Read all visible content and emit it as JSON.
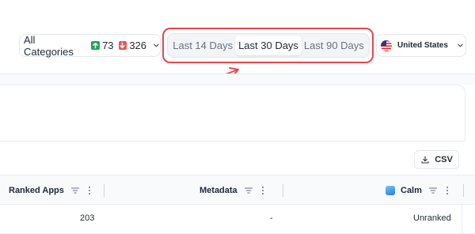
{
  "filters": {
    "category_label": "All Categories",
    "up_count": "73",
    "down_count": "326",
    "up_color": "#22a55a",
    "down_color": "#ef5350"
  },
  "date_range": {
    "options": [
      "Last 14 Days",
      "Last 30 Days",
      "Last 90 Days"
    ],
    "selected": "Last 30 Days",
    "highlight_color": "#e5484d"
  },
  "country": {
    "label": "United States",
    "flag_icon": "us-flag-icon"
  },
  "toolbar": {
    "csv_label": "CSV"
  },
  "table": {
    "columns": [
      "Ranked Apps",
      "Metadata",
      "Calm"
    ],
    "rows": [
      {
        "ranked_apps": "203",
        "metadata": "-",
        "calm": "Unranked"
      }
    ]
  }
}
